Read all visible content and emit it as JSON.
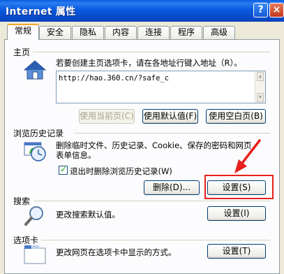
{
  "window": {
    "title": "Internet 属性",
    "help_label": "?",
    "close_label": "×"
  },
  "tabs": [
    "常规",
    "安全",
    "隐私",
    "内容",
    "连接",
    "程序",
    "高级"
  ],
  "home": {
    "group_title": "主页",
    "description": "若要创建主页选项卡，请在各地址行键入地址（R）。",
    "url": "http://hao.360.cn/?safe_c",
    "btn_current": "使用当前页(C)",
    "btn_default": "使用默认值(F)",
    "btn_blank": "使用空白页(B)"
  },
  "history": {
    "group_title": "浏览历史记录",
    "description_line1": "删除临时文件、历史记录、Cookie、保存的密码和网页",
    "description_line2": "表单信息。",
    "checkbox_label": "退出时删除浏览历史记录(W)",
    "btn_delete": "删除(D)...",
    "btn_settings": "设置(S)"
  },
  "search": {
    "group_title": "搜索",
    "description": "更改搜索默认值。",
    "btn_settings": "设置(I)"
  },
  "tabs_section": {
    "group_title": "选项卡",
    "description": "更改网页在选项卡中显示的方式。",
    "btn_settings": "设置(T)"
  },
  "colors": {
    "title_bar": "#0a5fe0",
    "highlight": "#e8201b"
  }
}
